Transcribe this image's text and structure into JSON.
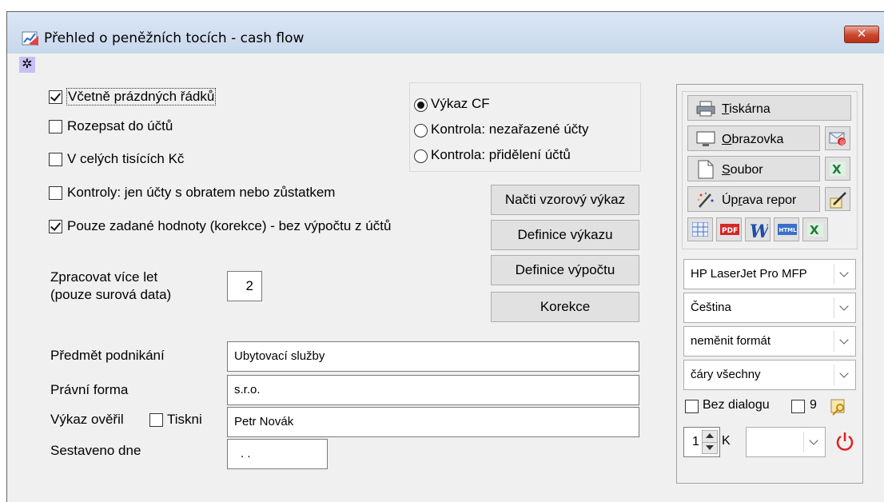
{
  "window": {
    "title": "Přehled o peněžních tocích - cash flow",
    "close_label": "✕"
  },
  "options": {
    "include_empty_rows": {
      "label": "Včetně prázdných řádků",
      "checked": true
    },
    "split_accounts": {
      "label": "Rozepsat do účtů",
      "checked": false
    },
    "thousands": {
      "label": "V celých tisících Kč",
      "checked": false
    },
    "controls_only": {
      "label": "Kontroly: jen účty s obratem nebo zůstatkem",
      "checked": false
    },
    "only_entered": {
      "label": "Pouze zadané hodnoty (korekce) - bez výpočtu z účtů",
      "checked": true
    }
  },
  "report_mode": {
    "options": [
      "Výkaz CF",
      "Kontrola: nezařazené účty",
      "Kontrola: přidělení účtů"
    ],
    "selected": 0
  },
  "buttons": {
    "load_template": "Načti vzorový výkaz",
    "report_definition": "Definice výkazu",
    "calc_definition": "Definice výpočtu",
    "correction": "Korekce"
  },
  "years": {
    "label_line1": "Zpracovat více let",
    "label_line2": "(pouze surová data)",
    "value": "2"
  },
  "fields": {
    "business": {
      "label": "Předmět podnikání",
      "value": "Ubytovací služby"
    },
    "legal_form": {
      "label": "Právní forma",
      "value": "s.r.o."
    },
    "verified": {
      "label": "Výkaz ověřil",
      "print_label": "Tiskni",
      "print_checked": false,
      "value": "Petr Novák"
    },
    "date": {
      "label": "Sestaveno dne",
      "value": ". ."
    }
  },
  "output": {
    "printer": {
      "pre": "",
      "key": "T",
      "post": "iskárna"
    },
    "screen": {
      "pre": "",
      "key": "O",
      "post": "brazovka"
    },
    "file": {
      "pre": "",
      "key": "S",
      "post": "oubor"
    },
    "edit_report": {
      "pre": "Úp",
      "key": "r",
      "post": "ava repor"
    },
    "printer_select": "HP LaserJet Pro MFP",
    "language_select": "Čeština",
    "format_select": "neměnit formát",
    "lines_select": "čáry všechny",
    "no_dialog_label": "Bez dialogu",
    "no_dialog_checked": false,
    "nine_label": "9",
    "nine_checked": false,
    "copies": "1",
    "copies_suffix": "K"
  },
  "icon_colors": {
    "excel": "#1f7a3a",
    "pdf": "#d2282a",
    "word": "#1d4fa8",
    "power": "#e02020"
  }
}
